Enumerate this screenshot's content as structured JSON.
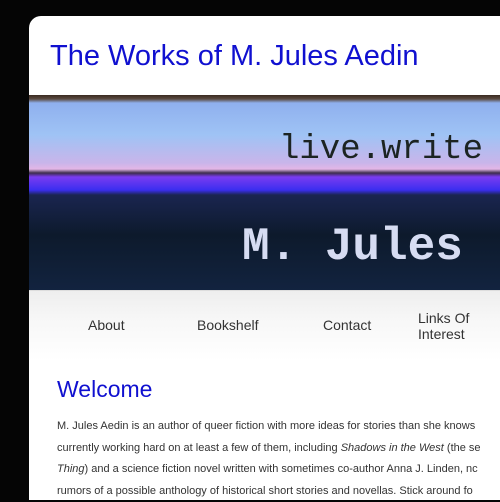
{
  "header": {
    "title": "The Works of M. Jules Aedin"
  },
  "banner": {
    "top_text": "live.write",
    "bottom_text": "M. Jules"
  },
  "nav": {
    "items": [
      {
        "label": "About"
      },
      {
        "label": "Bookshelf"
      },
      {
        "label": "Contact"
      },
      {
        "label": "Links Of Interest"
      }
    ]
  },
  "main": {
    "heading": "Welcome",
    "lines": [
      {
        "text": "M. Jules Aedin is an author of queer fiction with more ideas for stories than she knows"
      },
      {
        "pre": "currently working hard on at least a few of them, including ",
        "italic": "Shadows in the West",
        "post": " (the se"
      },
      {
        "italic": "Thing",
        "post": ") and a science fiction novel written with sometimes co-author Anna J. Linden, nc"
      },
      {
        "text": "rumors of a possible anthology of historical short stories and novellas. Stick around fo"
      }
    ]
  }
}
